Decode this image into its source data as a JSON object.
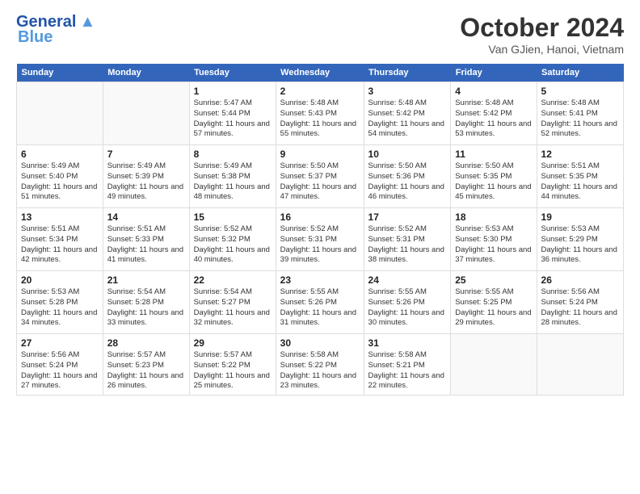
{
  "header": {
    "logo_general": "General",
    "logo_blue": "Blue",
    "month_title": "October 2024",
    "subtitle": "Van GJien, Hanoi, Vietnam"
  },
  "days_of_week": [
    "Sunday",
    "Monday",
    "Tuesday",
    "Wednesday",
    "Thursday",
    "Friday",
    "Saturday"
  ],
  "weeks": [
    [
      {
        "day": "",
        "content": ""
      },
      {
        "day": "",
        "content": ""
      },
      {
        "day": "1",
        "content": "Sunrise: 5:47 AM\nSunset: 5:44 PM\nDaylight: 11 hours and 57 minutes."
      },
      {
        "day": "2",
        "content": "Sunrise: 5:48 AM\nSunset: 5:43 PM\nDaylight: 11 hours and 55 minutes."
      },
      {
        "day": "3",
        "content": "Sunrise: 5:48 AM\nSunset: 5:42 PM\nDaylight: 11 hours and 54 minutes."
      },
      {
        "day": "4",
        "content": "Sunrise: 5:48 AM\nSunset: 5:42 PM\nDaylight: 11 hours and 53 minutes."
      },
      {
        "day": "5",
        "content": "Sunrise: 5:48 AM\nSunset: 5:41 PM\nDaylight: 11 hours and 52 minutes."
      }
    ],
    [
      {
        "day": "6",
        "content": "Sunrise: 5:49 AM\nSunset: 5:40 PM\nDaylight: 11 hours and 51 minutes."
      },
      {
        "day": "7",
        "content": "Sunrise: 5:49 AM\nSunset: 5:39 PM\nDaylight: 11 hours and 49 minutes."
      },
      {
        "day": "8",
        "content": "Sunrise: 5:49 AM\nSunset: 5:38 PM\nDaylight: 11 hours and 48 minutes."
      },
      {
        "day": "9",
        "content": "Sunrise: 5:50 AM\nSunset: 5:37 PM\nDaylight: 11 hours and 47 minutes."
      },
      {
        "day": "10",
        "content": "Sunrise: 5:50 AM\nSunset: 5:36 PM\nDaylight: 11 hours and 46 minutes."
      },
      {
        "day": "11",
        "content": "Sunrise: 5:50 AM\nSunset: 5:35 PM\nDaylight: 11 hours and 45 minutes."
      },
      {
        "day": "12",
        "content": "Sunrise: 5:51 AM\nSunset: 5:35 PM\nDaylight: 11 hours and 44 minutes."
      }
    ],
    [
      {
        "day": "13",
        "content": "Sunrise: 5:51 AM\nSunset: 5:34 PM\nDaylight: 11 hours and 42 minutes."
      },
      {
        "day": "14",
        "content": "Sunrise: 5:51 AM\nSunset: 5:33 PM\nDaylight: 11 hours and 41 minutes."
      },
      {
        "day": "15",
        "content": "Sunrise: 5:52 AM\nSunset: 5:32 PM\nDaylight: 11 hours and 40 minutes."
      },
      {
        "day": "16",
        "content": "Sunrise: 5:52 AM\nSunset: 5:31 PM\nDaylight: 11 hours and 39 minutes."
      },
      {
        "day": "17",
        "content": "Sunrise: 5:52 AM\nSunset: 5:31 PM\nDaylight: 11 hours and 38 minutes."
      },
      {
        "day": "18",
        "content": "Sunrise: 5:53 AM\nSunset: 5:30 PM\nDaylight: 11 hours and 37 minutes."
      },
      {
        "day": "19",
        "content": "Sunrise: 5:53 AM\nSunset: 5:29 PM\nDaylight: 11 hours and 36 minutes."
      }
    ],
    [
      {
        "day": "20",
        "content": "Sunrise: 5:53 AM\nSunset: 5:28 PM\nDaylight: 11 hours and 34 minutes."
      },
      {
        "day": "21",
        "content": "Sunrise: 5:54 AM\nSunset: 5:28 PM\nDaylight: 11 hours and 33 minutes."
      },
      {
        "day": "22",
        "content": "Sunrise: 5:54 AM\nSunset: 5:27 PM\nDaylight: 11 hours and 32 minutes."
      },
      {
        "day": "23",
        "content": "Sunrise: 5:55 AM\nSunset: 5:26 PM\nDaylight: 11 hours and 31 minutes."
      },
      {
        "day": "24",
        "content": "Sunrise: 5:55 AM\nSunset: 5:26 PM\nDaylight: 11 hours and 30 minutes."
      },
      {
        "day": "25",
        "content": "Sunrise: 5:55 AM\nSunset: 5:25 PM\nDaylight: 11 hours and 29 minutes."
      },
      {
        "day": "26",
        "content": "Sunrise: 5:56 AM\nSunset: 5:24 PM\nDaylight: 11 hours and 28 minutes."
      }
    ],
    [
      {
        "day": "27",
        "content": "Sunrise: 5:56 AM\nSunset: 5:24 PM\nDaylight: 11 hours and 27 minutes."
      },
      {
        "day": "28",
        "content": "Sunrise: 5:57 AM\nSunset: 5:23 PM\nDaylight: 11 hours and 26 minutes."
      },
      {
        "day": "29",
        "content": "Sunrise: 5:57 AM\nSunset: 5:22 PM\nDaylight: 11 hours and 25 minutes."
      },
      {
        "day": "30",
        "content": "Sunrise: 5:58 AM\nSunset: 5:22 PM\nDaylight: 11 hours and 23 minutes."
      },
      {
        "day": "31",
        "content": "Sunrise: 5:58 AM\nSunset: 5:21 PM\nDaylight: 11 hours and 22 minutes."
      },
      {
        "day": "",
        "content": ""
      },
      {
        "day": "",
        "content": ""
      }
    ]
  ]
}
